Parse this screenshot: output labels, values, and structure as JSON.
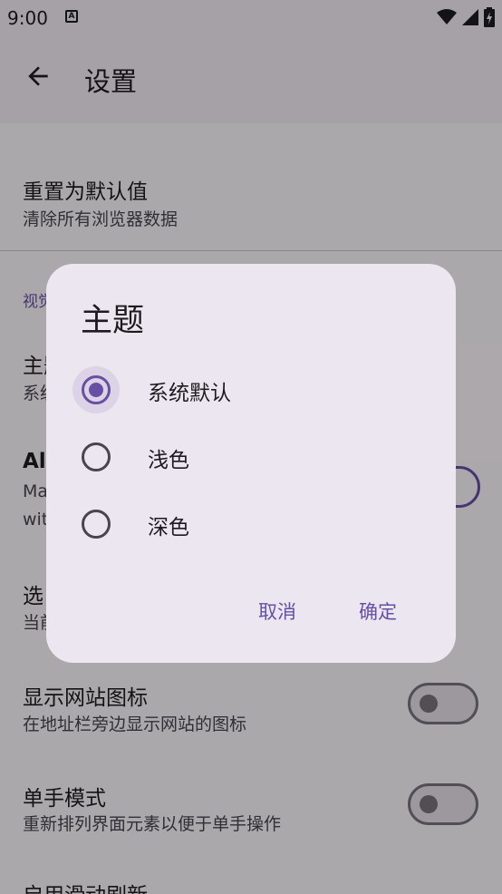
{
  "status_bar": {
    "time": "9:00",
    "notification_icon": "a-icon",
    "icons": [
      "wifi-icon",
      "signal-icon",
      "battery-charging-icon"
    ]
  },
  "app_bar": {
    "title": "设置",
    "back_icon": "arrow-back-icon"
  },
  "settings": {
    "reset": {
      "title": "重置为默认值",
      "subtitle": "清除所有浏览器数据"
    },
    "section_label": "视觉",
    "theme": {
      "title": "主题",
      "subtitle": "系统默认"
    },
    "all_item": {
      "title": "All",
      "subtitle_line1": "Ma",
      "subtitle_line2": "wit"
    },
    "select_item": {
      "title": "选",
      "subtitle": "当前"
    },
    "show_favicons": {
      "title": "显示网站图标",
      "subtitle": "在地址栏旁边显示网站的图标",
      "enabled": false
    },
    "one_hand_mode": {
      "title": "单手模式",
      "subtitle": "重新排列界面元素以便于单手操作",
      "enabled": false
    },
    "swipe_refresh": {
      "title": "启用滑动刷新"
    }
  },
  "dialog": {
    "title": "主题",
    "options": [
      {
        "label": "系统默认",
        "selected": true
      },
      {
        "label": "浅色",
        "selected": false
      },
      {
        "label": "深色",
        "selected": false
      }
    ],
    "cancel_label": "取消",
    "confirm_label": "确定"
  },
  "colors": {
    "accent": "#6750a4",
    "surface": "#fdf8fd",
    "dialog_surface": "#ece6f0",
    "text_primary": "#1d1b20",
    "text_secondary": "#49454f"
  }
}
